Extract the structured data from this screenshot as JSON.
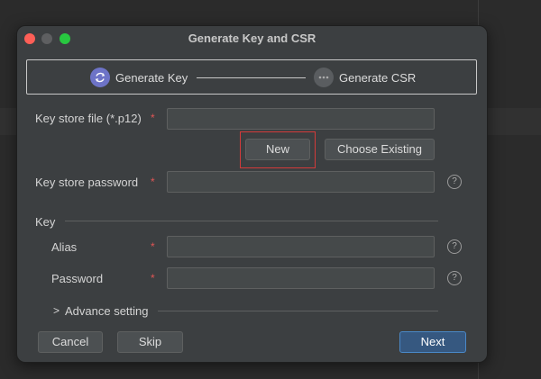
{
  "dialog": {
    "title": "Generate Key and CSR"
  },
  "steps": [
    {
      "label": "Generate Key",
      "active": true
    },
    {
      "label": "Generate CSR",
      "active": false
    }
  ],
  "form": {
    "keystore_file_label": "Key store file (*.p12)",
    "keystore_file_value": "",
    "required_mark": "*",
    "new_button": "New",
    "choose_existing_button": "Choose Existing",
    "keystore_password_label": "Key store password",
    "keystore_password_value": "",
    "key_section_label": "Key",
    "alias_label": "Alias",
    "alias_value": "",
    "password_label": "Password",
    "password_value": "",
    "help_glyph": "?",
    "advance_setting_label": "Advance setting",
    "advance_chevron": ">"
  },
  "footer": {
    "cancel_button": "Cancel",
    "skip_button": "Skip",
    "next_button": "Next"
  },
  "colors": {
    "dialog_bg": "#3c3f41",
    "accent_step": "#6d73c7",
    "primary_button": "#365880",
    "required": "#e05555",
    "highlight_box": "#d33a3a"
  }
}
